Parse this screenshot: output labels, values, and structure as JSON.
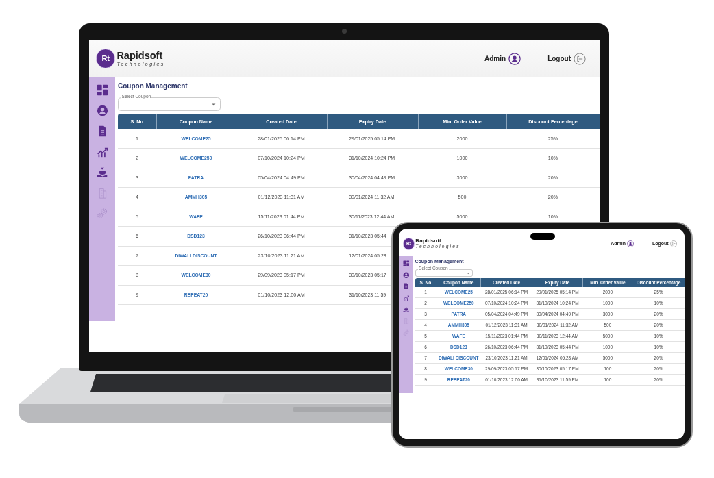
{
  "devices": [
    {
      "kind": "laptop",
      "screen": {
        "brand": {
          "mark": "Rt",
          "name": "Rapidsoft",
          "tagline": "Technologies"
        },
        "user": "Admin",
        "logout": "Logout",
        "title": "Coupon Management",
        "select_label": "Select Coupon",
        "columns": [
          {
            "label": "S. No",
            "kind": "text"
          },
          {
            "label": "Coupon Name",
            "kind": "link"
          },
          {
            "label": "Created Date",
            "kind": "text"
          },
          {
            "label": "Expiry Date",
            "kind": "text"
          },
          {
            "label": "Min. Order Value",
            "kind": "text"
          },
          {
            "label": "Discount Percentage",
            "kind": "text"
          }
        ],
        "rows": [
          {
            "cells": [
              "1",
              "WELCOME25",
              "28/01/2025 06:14 PM",
              "29/01/2025 05:14 PM",
              "2000",
              "25%"
            ]
          },
          {
            "cells": [
              "2",
              "WELCOME250",
              "07/10/2024 10:24 PM",
              "31/10/2024 10:24 PM",
              "1000",
              "10%"
            ]
          },
          {
            "cells": [
              "3",
              "PATRA",
              "05/04/2024 04:49 PM",
              "30/04/2024 04:49 PM",
              "3000",
              "20%"
            ]
          },
          {
            "cells": [
              "4",
              "AMMH305",
              "01/12/2023 11:31 AM",
              "30/01/2024 11:32 AM",
              "500",
              "20%"
            ]
          },
          {
            "cells": [
              "5",
              "WAFE",
              "15/11/2023 01:44 PM",
              "30/11/2023 12:44 AM",
              "5000",
              "10%"
            ]
          },
          {
            "cells": [
              "6",
              "DSD123",
              "26/10/2023 06:44 PM",
              "31/10/2023 05:44"
            ]
          },
          {
            "cells": [
              "7",
              "DIWALI DISCOUNT",
              "23/10/2023 11:21 AM",
              "12/01/2024 05:28"
            ]
          },
          {
            "cells": [
              "8",
              "WELCOME30",
              "29/09/2023 05:17 PM",
              "30/10/2023 05:17"
            ]
          },
          {
            "cells": [
              "9",
              "REPEAT20",
              "01/10/2023 12:00 AM",
              "31/10/2023 11:59"
            ]
          }
        ]
      }
    },
    {
      "kind": "tablet",
      "screen": {
        "brand": {
          "mark": "Rt",
          "name": "Rapidsoft",
          "tagline": "Technologies"
        },
        "user": "Admin",
        "logout": "Logout",
        "title": "Coupon Management",
        "select_label": "Select Coupon",
        "columns": [
          {
            "label": "S. No",
            "kind": "text"
          },
          {
            "label": "Coupon Name",
            "kind": "link"
          },
          {
            "label": "Created Date",
            "kind": "text"
          },
          {
            "label": "Expiry Date",
            "kind": "text"
          },
          {
            "label": "Min. Order Value",
            "kind": "text"
          },
          {
            "label": "Discount Percentage",
            "kind": "text"
          }
        ],
        "rows": [
          {
            "cells": [
              "1",
              "WELCOME25",
              "28/01/2025 06:14 PM",
              "29/01/2025 05:14 PM",
              "2000",
              "25%"
            ]
          },
          {
            "cells": [
              "2",
              "WELCOME250",
              "07/10/2024 10:24 PM",
              "31/10/2024 10:24 PM",
              "1000",
              "10%"
            ]
          },
          {
            "cells": [
              "3",
              "PATRA",
              "05/04/2024 04:49 PM",
              "30/04/2024 04:49 PM",
              "3000",
              "20%"
            ]
          },
          {
            "cells": [
              "4",
              "AMMH305",
              "01/12/2023 11:31 AM",
              "30/01/2024 11:32 AM",
              "500",
              "20%"
            ]
          },
          {
            "cells": [
              "5",
              "WAFE",
              "15/11/2023 01:44 PM",
              "30/11/2023 12:44 AM",
              "5000",
              "10%"
            ]
          },
          {
            "cells": [
              "6",
              "DSD123",
              "26/10/2023 06:44 PM",
              "31/10/2023 05:44 PM",
              "1000",
              "10%"
            ]
          },
          {
            "cells": [
              "7",
              "DIWALI DISCOUNT",
              "23/10/2023 11:21 AM",
              "12/01/2024 05:28 AM",
              "5000",
              "20%"
            ]
          },
          {
            "cells": [
              "8",
              "WELCOME30",
              "29/09/2023 05:17 PM",
              "30/10/2023 05:17 PM",
              "100",
              "20%"
            ]
          },
          {
            "cells": [
              "9",
              "REPEAT20",
              "01/10/2023 12:00 AM",
              "31/10/2023 11:59 PM",
              "100",
              "20%"
            ]
          }
        ]
      }
    }
  ]
}
